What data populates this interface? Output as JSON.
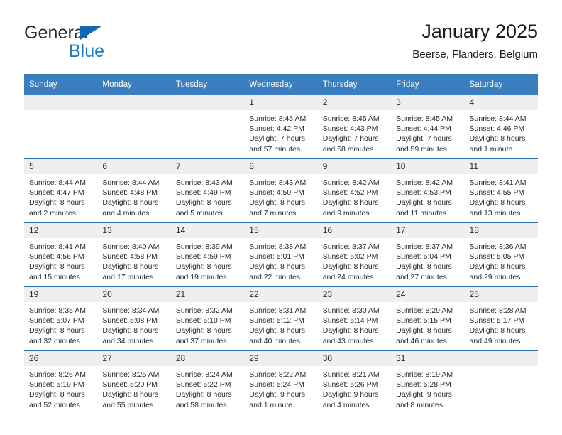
{
  "brand": {
    "word1": "General",
    "word2": "Blue",
    "triangle_color": "#1268b3",
    "blue_color": "#1a7ac4"
  },
  "header": {
    "title": "January 2025",
    "subtitle": "Beerse, Flanders, Belgium"
  },
  "theme": {
    "header_blue": "#3a7ebf",
    "row_divider_blue": "#2e6ca8",
    "daynum_band": "#efefef"
  },
  "weekday_headers": [
    "Sunday",
    "Monday",
    "Tuesday",
    "Wednesday",
    "Thursday",
    "Friday",
    "Saturday"
  ],
  "weeks": [
    [
      {
        "day": "",
        "sunrise": "",
        "sunset": "",
        "daylight1": "",
        "daylight2": ""
      },
      {
        "day": "",
        "sunrise": "",
        "sunset": "",
        "daylight1": "",
        "daylight2": ""
      },
      {
        "day": "",
        "sunrise": "",
        "sunset": "",
        "daylight1": "",
        "daylight2": ""
      },
      {
        "day": "1",
        "sunrise": "Sunrise: 8:45 AM",
        "sunset": "Sunset: 4:42 PM",
        "daylight1": "Daylight: 7 hours",
        "daylight2": "and 57 minutes."
      },
      {
        "day": "2",
        "sunrise": "Sunrise: 8:45 AM",
        "sunset": "Sunset: 4:43 PM",
        "daylight1": "Daylight: 7 hours",
        "daylight2": "and 58 minutes."
      },
      {
        "day": "3",
        "sunrise": "Sunrise: 8:45 AM",
        "sunset": "Sunset: 4:44 PM",
        "daylight1": "Daylight: 7 hours",
        "daylight2": "and 59 minutes."
      },
      {
        "day": "4",
        "sunrise": "Sunrise: 8:44 AM",
        "sunset": "Sunset: 4:46 PM",
        "daylight1": "Daylight: 8 hours",
        "daylight2": "and 1 minute."
      }
    ],
    [
      {
        "day": "5",
        "sunrise": "Sunrise: 8:44 AM",
        "sunset": "Sunset: 4:47 PM",
        "daylight1": "Daylight: 8 hours",
        "daylight2": "and 2 minutes."
      },
      {
        "day": "6",
        "sunrise": "Sunrise: 8:44 AM",
        "sunset": "Sunset: 4:48 PM",
        "daylight1": "Daylight: 8 hours",
        "daylight2": "and 4 minutes."
      },
      {
        "day": "7",
        "sunrise": "Sunrise: 8:43 AM",
        "sunset": "Sunset: 4:49 PM",
        "daylight1": "Daylight: 8 hours",
        "daylight2": "and 5 minutes."
      },
      {
        "day": "8",
        "sunrise": "Sunrise: 8:43 AM",
        "sunset": "Sunset: 4:50 PM",
        "daylight1": "Daylight: 8 hours",
        "daylight2": "and 7 minutes."
      },
      {
        "day": "9",
        "sunrise": "Sunrise: 8:42 AM",
        "sunset": "Sunset: 4:52 PM",
        "daylight1": "Daylight: 8 hours",
        "daylight2": "and 9 minutes."
      },
      {
        "day": "10",
        "sunrise": "Sunrise: 8:42 AM",
        "sunset": "Sunset: 4:53 PM",
        "daylight1": "Daylight: 8 hours",
        "daylight2": "and 11 minutes."
      },
      {
        "day": "11",
        "sunrise": "Sunrise: 8:41 AM",
        "sunset": "Sunset: 4:55 PM",
        "daylight1": "Daylight: 8 hours",
        "daylight2": "and 13 minutes."
      }
    ],
    [
      {
        "day": "12",
        "sunrise": "Sunrise: 8:41 AM",
        "sunset": "Sunset: 4:56 PM",
        "daylight1": "Daylight: 8 hours",
        "daylight2": "and 15 minutes."
      },
      {
        "day": "13",
        "sunrise": "Sunrise: 8:40 AM",
        "sunset": "Sunset: 4:58 PM",
        "daylight1": "Daylight: 8 hours",
        "daylight2": "and 17 minutes."
      },
      {
        "day": "14",
        "sunrise": "Sunrise: 8:39 AM",
        "sunset": "Sunset: 4:59 PM",
        "daylight1": "Daylight: 8 hours",
        "daylight2": "and 19 minutes."
      },
      {
        "day": "15",
        "sunrise": "Sunrise: 8:38 AM",
        "sunset": "Sunset: 5:01 PM",
        "daylight1": "Daylight: 8 hours",
        "daylight2": "and 22 minutes."
      },
      {
        "day": "16",
        "sunrise": "Sunrise: 8:37 AM",
        "sunset": "Sunset: 5:02 PM",
        "daylight1": "Daylight: 8 hours",
        "daylight2": "and 24 minutes."
      },
      {
        "day": "17",
        "sunrise": "Sunrise: 8:37 AM",
        "sunset": "Sunset: 5:04 PM",
        "daylight1": "Daylight: 8 hours",
        "daylight2": "and 27 minutes."
      },
      {
        "day": "18",
        "sunrise": "Sunrise: 8:36 AM",
        "sunset": "Sunset: 5:05 PM",
        "daylight1": "Daylight: 8 hours",
        "daylight2": "and 29 minutes."
      }
    ],
    [
      {
        "day": "19",
        "sunrise": "Sunrise: 8:35 AM",
        "sunset": "Sunset: 5:07 PM",
        "daylight1": "Daylight: 8 hours",
        "daylight2": "and 32 minutes."
      },
      {
        "day": "20",
        "sunrise": "Sunrise: 8:34 AM",
        "sunset": "Sunset: 5:08 PM",
        "daylight1": "Daylight: 8 hours",
        "daylight2": "and 34 minutes."
      },
      {
        "day": "21",
        "sunrise": "Sunrise: 8:32 AM",
        "sunset": "Sunset: 5:10 PM",
        "daylight1": "Daylight: 8 hours",
        "daylight2": "and 37 minutes."
      },
      {
        "day": "22",
        "sunrise": "Sunrise: 8:31 AM",
        "sunset": "Sunset: 5:12 PM",
        "daylight1": "Daylight: 8 hours",
        "daylight2": "and 40 minutes."
      },
      {
        "day": "23",
        "sunrise": "Sunrise: 8:30 AM",
        "sunset": "Sunset: 5:14 PM",
        "daylight1": "Daylight: 8 hours",
        "daylight2": "and 43 minutes."
      },
      {
        "day": "24",
        "sunrise": "Sunrise: 8:29 AM",
        "sunset": "Sunset: 5:15 PM",
        "daylight1": "Daylight: 8 hours",
        "daylight2": "and 46 minutes."
      },
      {
        "day": "25",
        "sunrise": "Sunrise: 8:28 AM",
        "sunset": "Sunset: 5:17 PM",
        "daylight1": "Daylight: 8 hours",
        "daylight2": "and 49 minutes."
      }
    ],
    [
      {
        "day": "26",
        "sunrise": "Sunrise: 8:26 AM",
        "sunset": "Sunset: 5:19 PM",
        "daylight1": "Daylight: 8 hours",
        "daylight2": "and 52 minutes."
      },
      {
        "day": "27",
        "sunrise": "Sunrise: 8:25 AM",
        "sunset": "Sunset: 5:20 PM",
        "daylight1": "Daylight: 8 hours",
        "daylight2": "and 55 minutes."
      },
      {
        "day": "28",
        "sunrise": "Sunrise: 8:24 AM",
        "sunset": "Sunset: 5:22 PM",
        "daylight1": "Daylight: 8 hours",
        "daylight2": "and 58 minutes."
      },
      {
        "day": "29",
        "sunrise": "Sunrise: 8:22 AM",
        "sunset": "Sunset: 5:24 PM",
        "daylight1": "Daylight: 9 hours",
        "daylight2": "and 1 minute."
      },
      {
        "day": "30",
        "sunrise": "Sunrise: 8:21 AM",
        "sunset": "Sunset: 5:26 PM",
        "daylight1": "Daylight: 9 hours",
        "daylight2": "and 4 minutes."
      },
      {
        "day": "31",
        "sunrise": "Sunrise: 8:19 AM",
        "sunset": "Sunset: 5:28 PM",
        "daylight1": "Daylight: 9 hours",
        "daylight2": "and 8 minutes."
      },
      {
        "day": "",
        "sunrise": "",
        "sunset": "",
        "daylight1": "",
        "daylight2": ""
      }
    ]
  ]
}
